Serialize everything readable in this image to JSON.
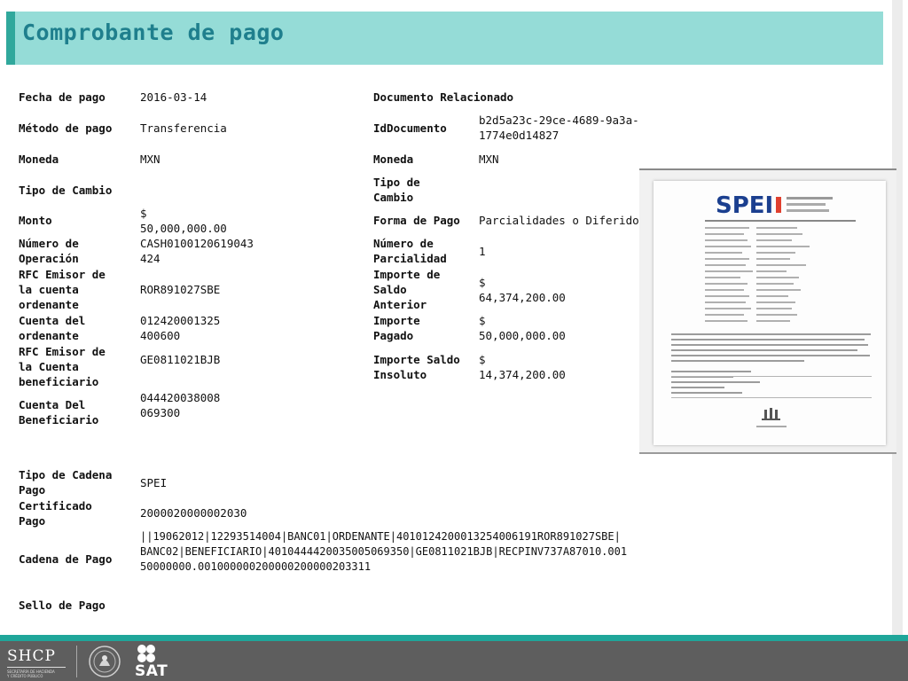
{
  "title": "Comprobante de pago",
  "left": {
    "fecha_label": "Fecha de pago",
    "fecha_value": "2016-03-14",
    "metodo_label": "Método de pago",
    "metodo_value": "Transferencia",
    "moneda_label": "Moneda",
    "moneda_value": "MXN",
    "tipo_cambio_label": "Tipo de Cambio",
    "monto_label": "Monto",
    "monto_value": " $\n50,000,000.00",
    "num_operacion_label": "Número de\nOperación",
    "num_operacion_value": "CASH0100120619043\n424",
    "rfc_ordenante_label": "RFC  Emisor de\nla cuenta\nordenante",
    "rfc_ordenante_value": "ROR891027SBE",
    "cuenta_ordenante_label": "Cuenta del\nordenante",
    "cuenta_ordenante_value": "012420001325\n400600",
    "rfc_beneficiario_label": "RFC Emisor de\nla Cuenta\nbeneficiario",
    "rfc_beneficiario_value": "GE0811021BJB",
    "cuenta_beneficiario_label": "Cuenta Del\nBeneficiario",
    "cuenta_beneficiario_value": "044420038008\n069300",
    "tipo_cadena_label": "Tipo de Cadena\nPago",
    "tipo_cadena_value": "SPEI",
    "certificado_label": "Certificado\nPago",
    "certificado_value": "2000020000002030",
    "cadena_label": "Cadena de Pago",
    "cadena_value": "||19062012|12293514004|BANC01|ORDENANTE|4010124200013254006191ROR891027SBE|\nBANC02|BENEFICIARIO|4010444420035005069350|GE0811021BJB|RECPINV737A87010.001\n50000000.001000000200000200000203311",
    "sello_label": "Sello de Pago"
  },
  "right": {
    "doc_rel_label": "Documento Relacionado",
    "iddoc_label": "IdDocumento",
    "iddoc_value": "b2d5a23c-29ce-4689-9a3a-\n1774e0d14827",
    "moneda_label": "Moneda",
    "moneda_value": "MXN",
    "tipo_cambio_label": "Tipo de\nCambio",
    "forma_pago_label": "Forma de Pago",
    "forma_pago_value": "Parcialidades o Diferido",
    "num_parcialidad_label": "Número de\nParcialidad",
    "num_parcialidad_value": "1",
    "saldo_anterior_label": "Importe de\nSaldo\nAnterior",
    "saldo_anterior_value": " $\n64,374,200.00",
    "importe_pagado_label": "Importe\nPagado",
    "importe_pagado_value": " $\n50,000,000.00",
    "saldo_insoluto_label": "Importe Saldo\nInsoluto",
    "saldo_insoluto_value": " $\n14,374,200.00"
  },
  "spei_image": {
    "logo_text": "SPEI"
  },
  "footer": {
    "shcp_text": "SHCP",
    "shcp_sub": "SECRETARÍA DE HACIENDA\nY CRÉDITO PÚBLICO",
    "sat_text": "SAT"
  },
  "colors": {
    "title_band": "#95dcd7",
    "title_accent": "#30a89c",
    "title_text": "#1f7f8d",
    "footer_band": "#5e5e5e",
    "footer_stripe": "#1fa69a"
  }
}
